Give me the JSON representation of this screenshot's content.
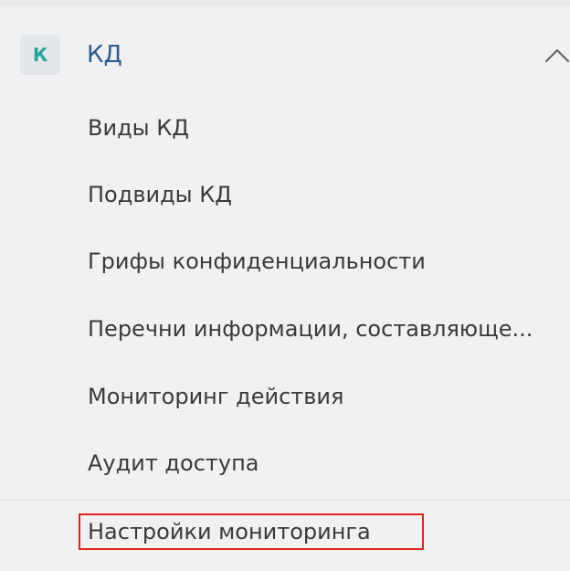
{
  "section": {
    "badge": "К",
    "title": "КД",
    "expanded": true,
    "chevron_icon": "chevron-up-icon"
  },
  "menu": {
    "items": [
      {
        "label": "Виды КД"
      },
      {
        "label": "Подвиды КД"
      },
      {
        "label": "Грифы конфиденциальности"
      },
      {
        "label": "Перечни информации, составляюще..."
      },
      {
        "label": "Мониторинг действия"
      },
      {
        "label": "Аудит доступа"
      },
      {
        "label": "Настройки мониторинга",
        "highlighted": true
      }
    ]
  },
  "colors": {
    "badge_text": "#2aa39a",
    "title_text": "#2d5c8f",
    "highlight_border": "#e2231a"
  }
}
